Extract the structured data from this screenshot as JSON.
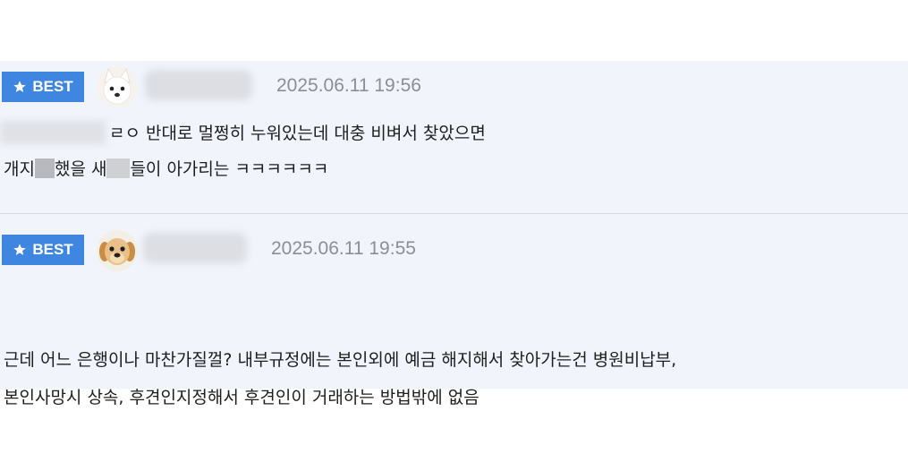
{
  "comments": [
    {
      "badge": {
        "label": "BEST",
        "icon": "star-icon"
      },
      "avatar": {
        "icon": "white-dog-avatar"
      },
      "timestamp": "2025.06.11 19:56",
      "line1": {
        "text": "ㄹㅇ 반대로 멀쩡히 누워있는데 대충 비벼서 찾았으면"
      },
      "line2": {
        "part1": "개지",
        "part2": " 했을 새",
        "part3": "들이 아가리는 ㅋㅋㅋㅋㅋㅋ"
      }
    },
    {
      "badge": {
        "label": "BEST",
        "icon": "star-icon"
      },
      "avatar": {
        "icon": "puppy-avatar"
      },
      "timestamp": "2025.06.11 19:55",
      "line1": "근데 어느 은행이나 마찬가질껄? 내부규정에는 본인외에 예금 해지해서 찾아가는건 병원비납부,",
      "line2": "본인사망시 상속, 후견인지정해서 후견인이 거래하는 방법밖에 없음"
    }
  ],
  "colors": {
    "panel_bg": "#f1f4fb",
    "badge_bg": "#3f86e0",
    "timestamp": "#8a8e99"
  }
}
